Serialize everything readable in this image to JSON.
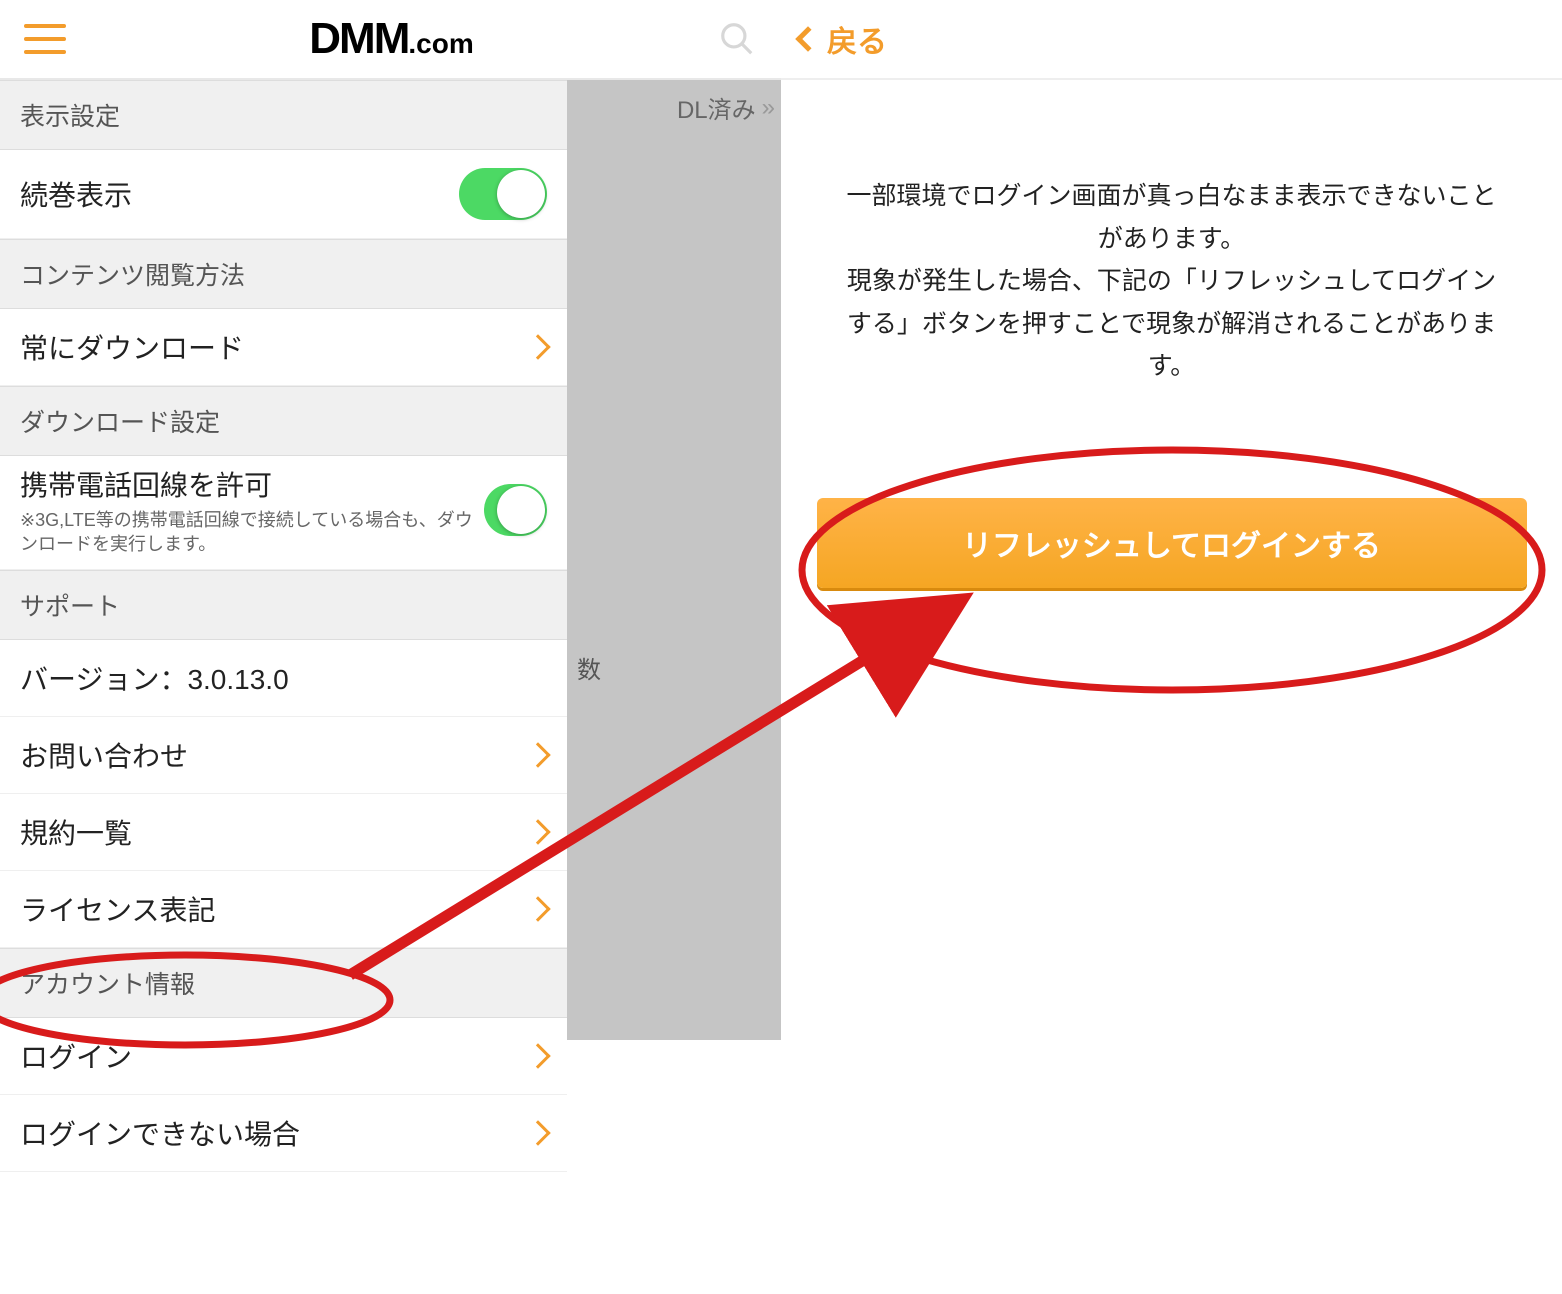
{
  "left": {
    "header": {
      "logo_big": "DMM",
      "logo_small": ".com"
    },
    "backdrop": {
      "chip_label": "DL済み",
      "bk_char": "数"
    },
    "sections": {
      "display": {
        "header": "表示設定",
        "sequel_label": "続巻表示"
      },
      "viewing": {
        "header": "コンテンツ閲覧方法",
        "always_dl": "常にダウンロード"
      },
      "download": {
        "header": "ダウンロード設定",
        "cell_title": "携帯電話回線を許可",
        "cell_sub": "※3G,LTE等の携帯電話回線で接続している場合も、ダウンロードを実行します。"
      },
      "support": {
        "header": "サポート",
        "version_label": "バージョン：3.0.13.0",
        "contact": "お問い合わせ",
        "terms": "規約一覧",
        "license": "ライセンス表記"
      },
      "account": {
        "header": "アカウント情報",
        "login": "ログイン",
        "cannot_login": "ログインできない場合"
      }
    }
  },
  "right": {
    "back_label": "戻る",
    "info_text": "一部環境でログイン画面が真っ白なまま表示できないことがあります。\n現象が発生した場合、下記の「リフレッシュしてログインする」ボタンを押すことで現象が解消されることがあります。",
    "refresh_button": "リフレッシュしてログインする"
  },
  "annotation": {
    "arrow_color": "#d81b1b",
    "source_ellipse_label": "ログインできない場合",
    "target_ellipse_label": "リフレッシュしてログインする"
  }
}
